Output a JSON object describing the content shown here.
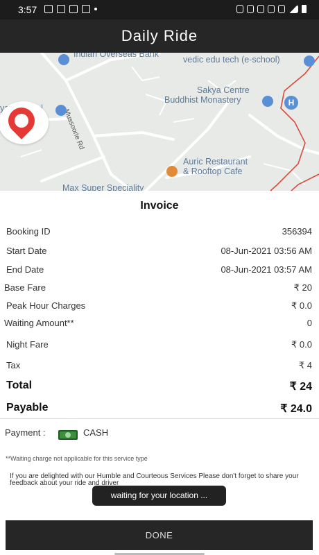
{
  "status_bar": {
    "time": "3:57"
  },
  "header": {
    "title": "Daily Ride"
  },
  "map": {
    "labels": {
      "bank": "Indian Overseas Bank",
      "edu": "vedic edu tech (e-school)",
      "school": "yan School",
      "road": "Mussoorie Rd",
      "monastery_1": "Sakya Centre",
      "monastery_2": "Buddhist Monastery",
      "restaurant_1": "Auric Restaurant",
      "restaurant_2": "& Rooftop Cafe",
      "hospital": "Max Super Speciality",
      "hospital_badge": "H"
    }
  },
  "invoice": {
    "title": "Invoice",
    "rows": [
      {
        "label": "Booking ID",
        "value": "356394"
      },
      {
        "label": "Start Date",
        "value": "08-Jun-2021 03:56 AM"
      },
      {
        "label": "End Date",
        "value": "08-Jun-2021 03:57 AM"
      },
      {
        "label": "Base Fare",
        "value": "₹  20"
      },
      {
        "label": "Peak Hour Charges",
        "value": "₹ 0.0"
      },
      {
        "label": "Waiting Amount**",
        "value": "0"
      },
      {
        "label": "Night Fare",
        "value": "₹ 0.0"
      },
      {
        "label": "Tax",
        "value": "₹ 4"
      },
      {
        "label": "Total",
        "value": "₹ 24"
      },
      {
        "label": "Payable",
        "value": "₹ 24.0"
      }
    ]
  },
  "payment": {
    "label": "Payment :",
    "value": "CASH",
    "icon": "cash-icon"
  },
  "notes": {
    "waiting": "**Waiting charge not applicable for this service type",
    "feedback": "If you are delighted with our Humble and Courteous Services Please don't forget to share your feedback about your ride and driver"
  },
  "toast": {
    "text": "waiting for your location ..."
  },
  "actions": {
    "done_label": "DONE"
  },
  "colors": {
    "appbar": "#262626",
    "brand_red": "#e53935",
    "map_bg": "#e8eae7"
  }
}
